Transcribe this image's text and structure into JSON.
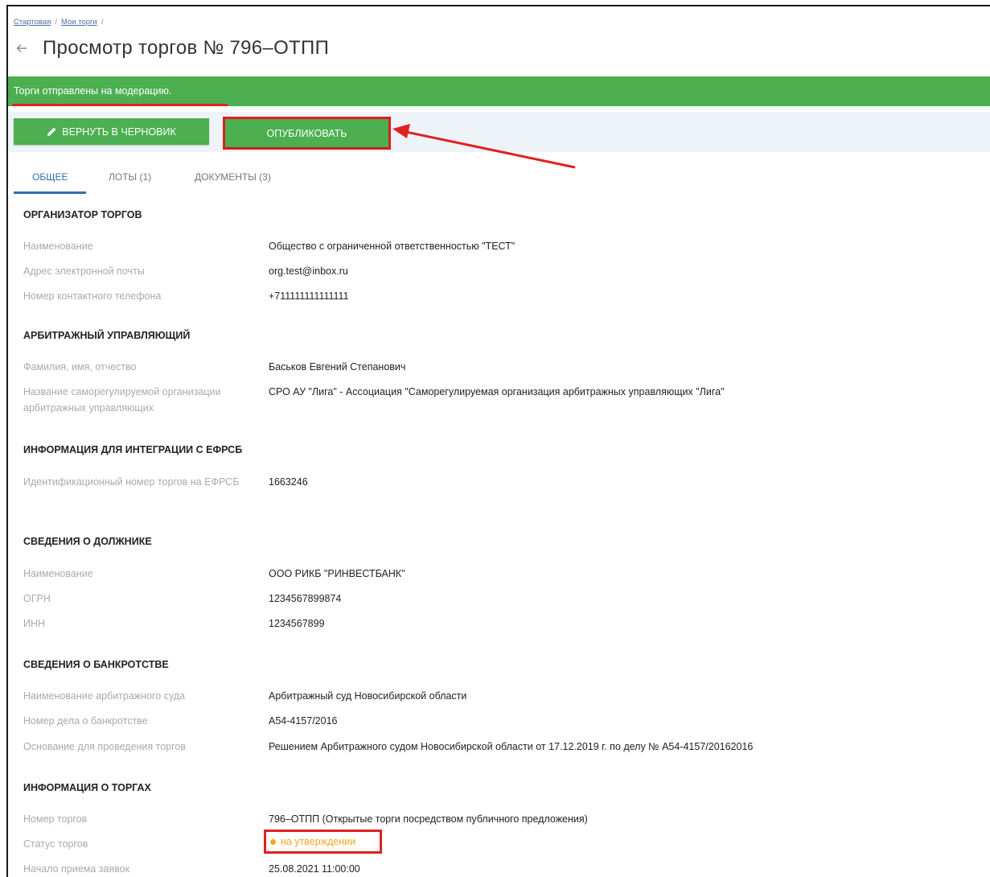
{
  "breadcrumb": {
    "home": "Стартовая",
    "my_trades": "Мои торги"
  },
  "page": {
    "title": "Просмотр торгов № 796–ОТПП"
  },
  "banner": {
    "text": "Торги отправлены на модерацию."
  },
  "toolbar": {
    "draft_label": "Вернуть в черновик",
    "publish_label": "Опубликовать"
  },
  "tabs": [
    {
      "label": "Общее"
    },
    {
      "label": "Лоты (1)"
    },
    {
      "label": "Документы (3)"
    }
  ],
  "organizer": {
    "heading": "ОРГАНИЗАТОР ТОРГОВ",
    "rows": [
      {
        "label": "Наименование",
        "value": "Общество с ограниченной ответственностью \"ТЕСТ\""
      },
      {
        "label": "Адрес электронной почты",
        "value": "org.test@inbox.ru"
      },
      {
        "label": "Номер контактного телефона",
        "value": "+711111111111111"
      }
    ]
  },
  "manager": {
    "heading": "АРБИТРАЖНЫЙ УПРАВЛЯЮЩИЙ",
    "rows": [
      {
        "label": "Фамилия, имя, отчество",
        "value": "Баськов Евгений Степанович"
      },
      {
        "label": "Название саморегулируемой организации арбитражных управляющих",
        "value": "СРО АУ \"Лига\" - Ассоциация \"Саморегулируемая организация арбитражных управляющих \"Лига\""
      }
    ]
  },
  "integration": {
    "heading": "ИНФОРМАЦИЯ ДЛЯ ИНТЕГРАЦИИ С ЕФРСБ",
    "rows": [
      {
        "label": "Идентификационный номер торгов на ЕФРСБ",
        "value": "1663246"
      }
    ]
  },
  "debtor": {
    "heading": "СВЕДЕНИЯ О ДОЛЖНИКЕ",
    "rows": [
      {
        "label": "Наименование",
        "value": "ООО РИКБ \"РИНВЕСТБАНК\""
      },
      {
        "label": "ОГРН",
        "value": "1234567899874"
      },
      {
        "label": "ИНН",
        "value": "1234567899"
      }
    ]
  },
  "bankruptcy": {
    "heading": "СВЕДЕНИЯ О БАНКРОТСТВЕ",
    "rows": [
      {
        "label": "Наименование арбитражного суда",
        "value": "Арбитражный суд Новосибирской области"
      },
      {
        "label": "Номер дела о банкротстве",
        "value": "А54-4157/2016"
      },
      {
        "label": "Основание для проведения торгов",
        "value": "Решением Арбитражного судом Новосибирской области от 17.12.2019 г. по делу № А54-4157/20162016"
      }
    ]
  },
  "trades": {
    "heading": "ИНФОРМАЦИЯ О ТОРГАХ",
    "rows": [
      {
        "label": "Номер торгов",
        "value": "796–ОТПП (Открытые торги посредством публичного предложения)"
      },
      {
        "label": "Статус торгов",
        "value": "на утверждении"
      },
      {
        "label": "Начало приема заявок",
        "value": "25.08.2021 11:00:00"
      }
    ]
  },
  "colors": {
    "banner": "#4caf50",
    "accent": "#2f6fb0",
    "annotation": "#e02020",
    "status": "#f5a623"
  },
  "icons": [
    "back-arrow-icon",
    "pencil-icon",
    "status-dot-icon"
  ]
}
